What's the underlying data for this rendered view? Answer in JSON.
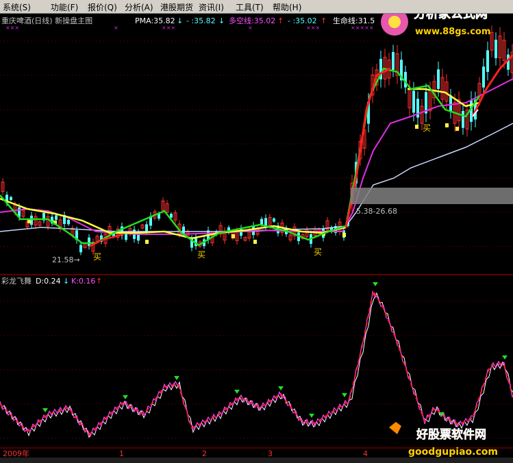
{
  "menu": [
    "系统(S)",
    "功能(F)",
    "报价(Q)",
    "分析(A)",
    "港股期货",
    "资讯(I)",
    "工具(T)",
    "帮助(H)"
  ],
  "menu_dot": "交",
  "logo": {
    "line1": "分析家公式网",
    "line2": "www.88gs.com"
  },
  "main_header": {
    "title": "重庆啤酒(日线) 新操盘主图",
    "pma_label": "PMA:35.82",
    "pma_arrow": "↓",
    "pma2": "- :35.82",
    "pma2_arrow": "↓",
    "dkx": "多空线:35.02",
    "dkx_arrow": "↑",
    "dkx2": "- :35.02",
    "dkx2_arrow": "↑",
    "life": "生命线:31.5"
  },
  "annotations": {
    "low_price": "21.58→",
    "buy": "买",
    "range_label": "5.38-26.68"
  },
  "sub_header": {
    "title": "彩龙飞舞",
    "d": "D:0.24",
    "d_arrow": "↓",
    "k": "K:0.16",
    "k_arrow": "↑"
  },
  "x_axis": {
    "year": "2009年",
    "ticks": [
      "1",
      "2",
      "3",
      "4"
    ]
  },
  "watermark": {
    "line1": "好股票软件网",
    "line2": "goodgupiao.com"
  },
  "colors": {
    "up": "#ff3030",
    "down": "#54ffff",
    "ma_yellow": "#ffff40",
    "ma_green": "#20e020",
    "ma_magenta": "#e030e0",
    "ma_white": "#c8d8ff",
    "red_line": "#ff2020",
    "grid": "#800000"
  },
  "chart_data": {
    "type": "line",
    "series": [
      {
        "name": "PMA",
        "values": []
      },
      {
        "name": "多空线",
        "values": []
      },
      {
        "name": "生命线",
        "values": []
      }
    ]
  }
}
